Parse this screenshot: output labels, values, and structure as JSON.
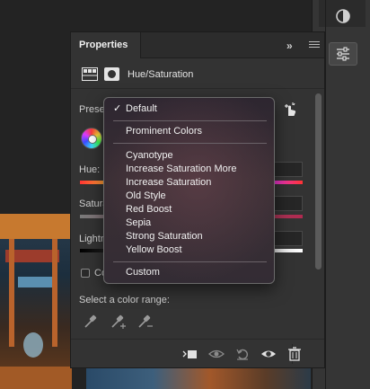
{
  "panel": {
    "tab_label": "Properties",
    "adjustment_name": "Hue/Saturation"
  },
  "controls": {
    "preset_label": "Prese",
    "hue_label": "Hue:",
    "saturation_label": "Satura",
    "lightness_label": "Lightn",
    "colorize_label": "Co",
    "color_range_label": "Select a color range:"
  },
  "preset_menu": {
    "checked_item": "Default",
    "items": [
      "Default",
      "Prominent Colors",
      "Cyanotype",
      "Increase Saturation More",
      "Increase Saturation",
      "Old Style",
      "Red Boost",
      "Sepia",
      "Strong Saturation",
      "Yellow Boost",
      "Custom"
    ]
  },
  "icons": {
    "header": [
      "collapse-icon",
      "panel-menu-icon"
    ],
    "layer_row": [
      "adjustment-layer-icon",
      "layer-mask-icon"
    ],
    "eyedroppers": [
      "eyedropper-icon",
      "eyedropper-add-icon",
      "eyedropper-subtract-icon"
    ],
    "footer": [
      "clip-to-layer-icon",
      "view-previous-state-icon",
      "reset-icon",
      "visibility-eye-icon",
      "trash-icon"
    ],
    "right_strip": [
      "color-swatch-icon",
      "adjustments-icon"
    ]
  }
}
